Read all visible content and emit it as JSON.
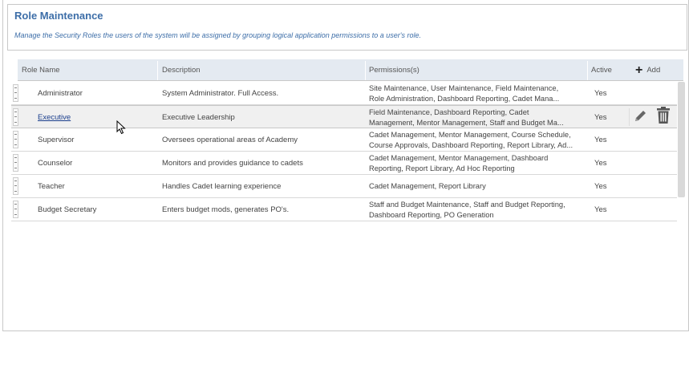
{
  "page": {
    "title": "Role Maintenance",
    "description": "Manage the Security Roles the users of the system will be assigned by grouping logical application permissions to a user's role."
  },
  "grid": {
    "columns": {
      "role_name": "Role Name",
      "description": "Description",
      "permissions": "Permissions(s)",
      "active": "Active",
      "add": "Add"
    },
    "rows": [
      {
        "role_name": "Administrator",
        "description": "System Administrator. Full Access.",
        "permissions_line1": "Site Maintenance, User Maintenance, Field Maintenance,",
        "permissions_line2": "Role Administration, Dashboard Reporting, Cadet Mana...",
        "active": "Yes"
      },
      {
        "role_name": "Executive",
        "description": "Executive Leadership",
        "permissions_line1": "Field Maintenance, Dashboard Reporting, Cadet",
        "permissions_line2": "Management, Mentor Management, Staff and Budget Ma...",
        "active": "Yes"
      },
      {
        "role_name": "Supervisor",
        "description": "Oversees operational areas of Academy",
        "permissions_line1": "Cadet Management, Mentor Management, Course Schedule,",
        "permissions_line2": "Course Approvals, Dashboard Reporting, Report Library, Ad...",
        "active": "Yes"
      },
      {
        "role_name": "Counselor",
        "description": "Monitors and provides guidance to cadets",
        "permissions_line1": "Cadet Management, Mentor Management, Dashboard",
        "permissions_line2": "Reporting, Report Library, Ad Hoc Reporting",
        "active": "Yes"
      },
      {
        "role_name": "Teacher",
        "description": "Handles Cadet learning experience",
        "permissions_line1": "Cadet Management, Report Library",
        "permissions_line2": "",
        "active": "Yes"
      },
      {
        "role_name": "Budget Secretary",
        "description": "Enters budget mods, generates PO's.",
        "permissions_line1": "Staff and Budget Maintenance, Staff and Budget Reporting,",
        "permissions_line2": "Dashboard Reporting, PO Generation",
        "active": "Yes"
      }
    ],
    "selected_row": "Executive",
    "row_actions": [
      "pencil-icon",
      "trash-icon"
    ]
  },
  "colors": {
    "title": "#3d6ea8",
    "header_bg": "#e4eaf1",
    "selected_row_bg": "#f0f0f0",
    "link": "#1a3e8c"
  }
}
